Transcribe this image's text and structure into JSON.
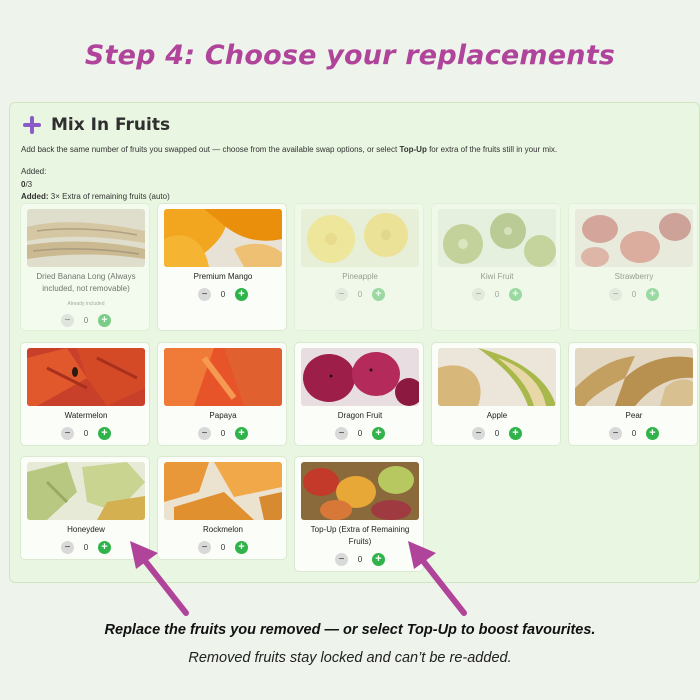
{
  "heading": "Step 4: Choose your replacements",
  "panel": {
    "title": "Mix In Fruits",
    "icon": "plus-icon",
    "description_before": "Add back the same number of fruits you swapped out — choose from the available swap options, or select ",
    "description_bold": "Top-Up",
    "description_after": " for extra of the fruits still in your mix.",
    "added_label": "Added:",
    "count_value": "0",
    "count_total": "/3",
    "added_line_label": "Added:",
    "added_line_value": " 3× Extra of remaining fruits (auto)"
  },
  "cards": [
    {
      "name": "Dried Banana Long (Always included, not removable)",
      "note": "Already included",
      "qty": "0",
      "state": "locked",
      "minus": "−",
      "plus": "+"
    },
    {
      "name": "Premium Mango",
      "qty": "0",
      "state": "active",
      "minus": "−",
      "plus": "+"
    },
    {
      "name": "Pineapple",
      "qty": "0",
      "state": "disabled",
      "minus": "−",
      "plus": "+"
    },
    {
      "name": "Kiwi Fruit",
      "qty": "0",
      "state": "disabled",
      "minus": "−",
      "plus": "+"
    },
    {
      "name": "Strawberry",
      "qty": "0",
      "state": "disabled",
      "minus": "−",
      "plus": "+"
    },
    {
      "name": "Watermelon",
      "qty": "0",
      "state": "active",
      "minus": "−",
      "plus": "+"
    },
    {
      "name": "Papaya",
      "qty": "0",
      "state": "active",
      "minus": "−",
      "plus": "+"
    },
    {
      "name": "Dragon Fruit",
      "qty": "0",
      "state": "active",
      "minus": "−",
      "plus": "+"
    },
    {
      "name": "Apple",
      "qty": "0",
      "state": "active",
      "minus": "−",
      "plus": "+"
    },
    {
      "name": "Pear",
      "qty": "0",
      "state": "active",
      "minus": "−",
      "plus": "+"
    },
    {
      "name": "Honeydew",
      "qty": "0",
      "state": "active",
      "minus": "−",
      "plus": "+"
    },
    {
      "name": "Rockmelon",
      "qty": "0",
      "state": "active",
      "minus": "−",
      "plus": "+"
    },
    {
      "name": "Top-Up (Extra of Remaining Fruits)",
      "qty": "0",
      "state": "active",
      "minus": "−",
      "plus": "+"
    }
  ],
  "footer": {
    "line1": "Replace the fruits you removed — or select Top-Up to boost favourites.",
    "line2": "Removed fruits stay locked and can’t be re-added."
  },
  "colors": {
    "heading": "#b0449a",
    "arrow": "#b0449a",
    "plus_button": "#2fb34a",
    "panel_bg": "#e9f6e1"
  }
}
